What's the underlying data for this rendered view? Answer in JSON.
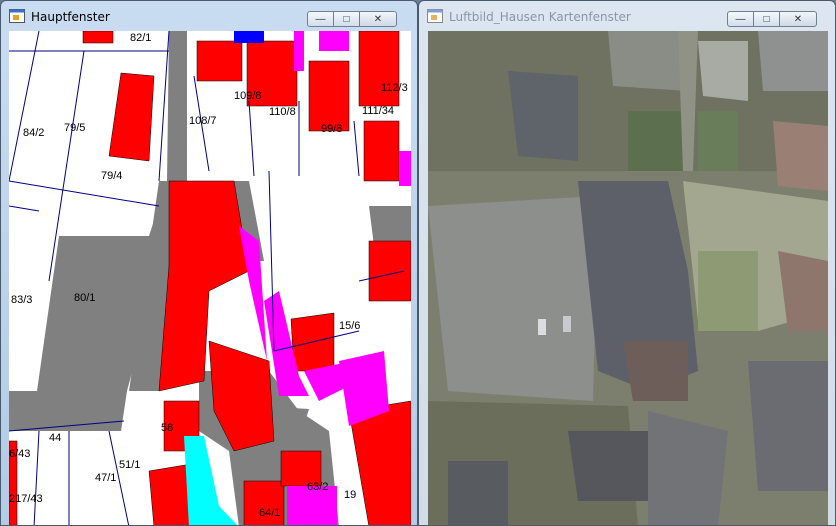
{
  "windows": {
    "main": {
      "title": "Hauptfenster",
      "controls": {
        "minimize": "—",
        "maximize": "□",
        "close": "✕"
      },
      "parcels": [
        "82/1",
        "84/2",
        "79/5",
        "108/7",
        "109/8",
        "110/8",
        "99/8",
        "111/34",
        "112/3",
        "79/4",
        "83/3",
        "80/1",
        "15/6",
        "44",
        "6/43",
        "58",
        "51/1",
        "47/1",
        "217/43",
        "63/2",
        "19",
        "64/1"
      ]
    },
    "aerial": {
      "title": "Luftbild_Hausen Kartenfenster",
      "controls": {
        "minimize": "—",
        "maximize": "□",
        "close": "✕"
      }
    }
  },
  "colors": {
    "building": "#ff0000",
    "special_building": "#ff00ff",
    "public_area": "#808080",
    "water": "#00ffff",
    "parcel_line": "#000080"
  }
}
